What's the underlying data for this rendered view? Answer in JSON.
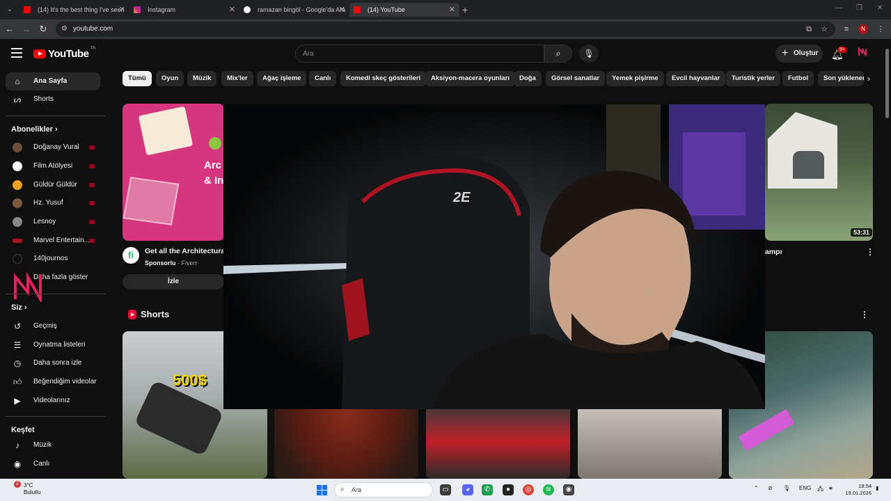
{
  "browser": {
    "tabs": [
      {
        "label": "(14) It's the best thing I've seen",
        "active": false
      },
      {
        "label": "Instagram",
        "active": false
      },
      {
        "label": "ramazan bingöl - Google'da Ara",
        "active": false
      },
      {
        "label": "(14) YouTube",
        "active": true
      }
    ],
    "url": "youtube.com"
  },
  "header": {
    "logo_text": "YouTube",
    "country": "TR",
    "search_placeholder": "Ara",
    "create_label": "Oluştur",
    "notif_badge": "9+"
  },
  "sidebar": {
    "main": [
      {
        "label": "Ana Sayfa",
        "icon": "home-icon",
        "active": true
      },
      {
        "label": "Shorts",
        "icon": "shorts-icon",
        "active": false
      }
    ],
    "subs_heading": "Abonelikler",
    "subscriptions": [
      {
        "label": "Doğanay Vural",
        "color": "#6b4f3a"
      },
      {
        "label": "Film Atölyesi",
        "color": "#ffffff"
      },
      {
        "label": "Güldür Güldür",
        "color": "#e8a31b"
      },
      {
        "label": "Hz. Yusuf",
        "color": "#7a5a3b"
      },
      {
        "label": "Lesnoy",
        "color": "#888888"
      },
      {
        "label": "Marvel Entertain...",
        "color": "#b0121a"
      },
      {
        "label": "140journos",
        "color": "#111111"
      }
    ],
    "show_more": "Daha fazla göster",
    "you_heading": "Siz",
    "you_items": [
      {
        "label": "Geçmiş",
        "icon": "history-icon"
      },
      {
        "label": "Oynatma listeleri",
        "icon": "playlists-icon"
      },
      {
        "label": "Daha sonra izle",
        "icon": "watch-later-icon"
      },
      {
        "label": "Beğendiğim videolar",
        "icon": "like-icon"
      },
      {
        "label": "Videolarınız",
        "icon": "your-videos-icon"
      }
    ],
    "explore_heading": "Keşfet",
    "explore_items": [
      {
        "label": "Müzik",
        "icon": "music-icon"
      },
      {
        "label": "Canlı",
        "icon": "live-icon"
      }
    ]
  },
  "chips": [
    "Tümü",
    "Oyun",
    "Müzik",
    "Mix'ler",
    "Ağaç işleme",
    "Canlı",
    "Komedi skeç gösterileri",
    "Aksiyon-macera oyunları",
    "Doğa",
    "Görsel sanatlar",
    "Yemek pişirme",
    "Evcil hayvanlar",
    "Turistik yerler",
    "Futbol",
    "Son yüklenenler"
  ],
  "ad": {
    "thumb_text": "Arc\n& Inte",
    "title": "Get all the Architectural",
    "sponsored": "Sponsorlu",
    "advertiser": "Fiverr",
    "cta": "İzle"
  },
  "video_right": {
    "duration": "53:31",
    "title_fragment": "ampı"
  },
  "shorts": {
    "heading": "Shorts",
    "first_text": "500$"
  },
  "taskbar": {
    "temp": "3°C",
    "weather": "Bulutlu",
    "weather_badge": "2",
    "search": "Ara",
    "lang": "ENG",
    "time": "18:54",
    "date": "19.01.2026"
  }
}
